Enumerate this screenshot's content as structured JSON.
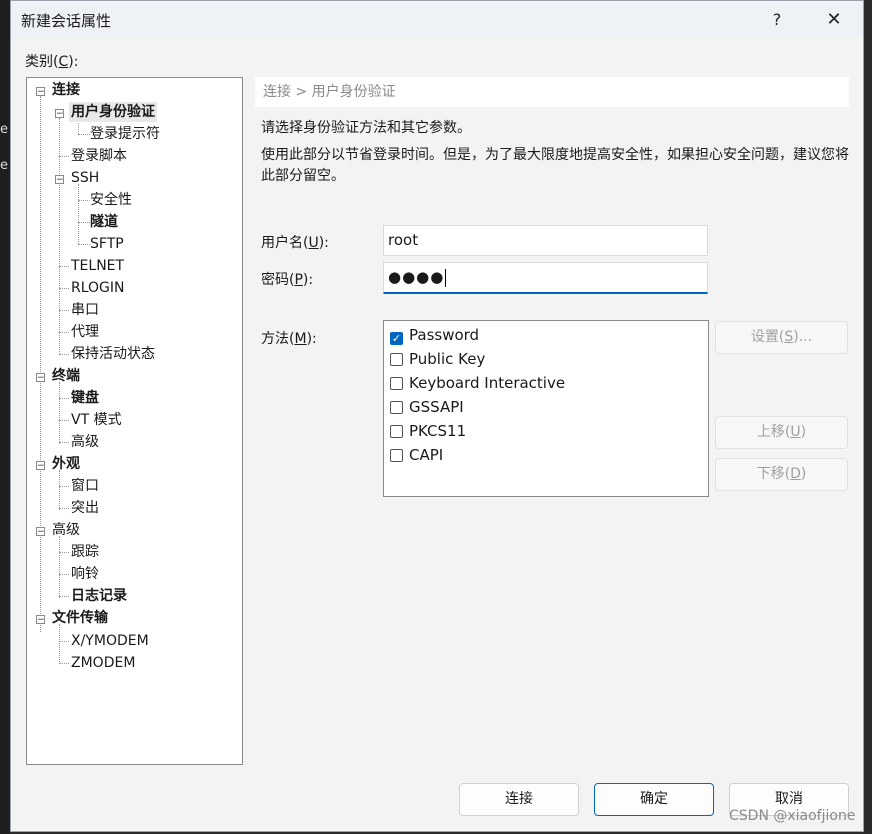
{
  "window": {
    "title": "新建会话属性",
    "help": "?",
    "close": "✕"
  },
  "background": {
    "letters": [
      "e",
      "e"
    ]
  },
  "category_label": {
    "text": "类别(",
    "key": "C",
    "suffix": "):"
  },
  "tree": {
    "nodes": [
      {
        "label": "连接",
        "bold": true,
        "expanded": true
      },
      {
        "label": "用户身份验证",
        "bold": true,
        "selected": true,
        "expanded": true
      },
      {
        "label": "登录提示符"
      },
      {
        "label": "登录脚本"
      },
      {
        "label": "SSH",
        "expanded": true
      },
      {
        "label": "安全性"
      },
      {
        "label": "隧道",
        "bold": true
      },
      {
        "label": "SFTP"
      },
      {
        "label": "TELNET"
      },
      {
        "label": "RLOGIN"
      },
      {
        "label": "串口"
      },
      {
        "label": "代理"
      },
      {
        "label": "保持活动状态"
      },
      {
        "label": "终端",
        "bold": true,
        "expanded": true
      },
      {
        "label": "键盘",
        "bold": true
      },
      {
        "label": "VT 模式"
      },
      {
        "label": "高级"
      },
      {
        "label": "外观",
        "bold": true,
        "expanded": true
      },
      {
        "label": "窗口"
      },
      {
        "label": "突出"
      },
      {
        "label": "高级",
        "expanded": true
      },
      {
        "label": "跟踪"
      },
      {
        "label": "响铃"
      },
      {
        "label": "日志记录",
        "bold": true
      },
      {
        "label": "文件传输",
        "bold": true,
        "expanded": true
      },
      {
        "label": "X/YMODEM"
      },
      {
        "label": "ZMODEM"
      }
    ],
    "expander_glyph": "−"
  },
  "breadcrumb": "连接 > 用户身份验证",
  "description": {
    "line1": "请选择身份验证方法和其它参数。",
    "line2": "使用此部分以节省登录时间。但是，为了最大限度地提高安全性，如果担心安全问题，建议您将此部分留空。"
  },
  "fields": {
    "username": {
      "label": "用户名(",
      "key": "U",
      "suffix": "):",
      "value": "root"
    },
    "password": {
      "label": "密码(",
      "key": "P",
      "suffix": "):",
      "value": "●●●●"
    },
    "method": {
      "label": "方法(",
      "key": "M",
      "suffix": "):"
    }
  },
  "methods": [
    {
      "label": "Password",
      "checked": true
    },
    {
      "label": "Public Key",
      "checked": false
    },
    {
      "label": "Keyboard Interactive",
      "checked": false
    },
    {
      "label": "GSSAPI",
      "checked": false
    },
    {
      "label": "PKCS11",
      "checked": false
    },
    {
      "label": "CAPI",
      "checked": false
    }
  ],
  "check_glyph": "✓",
  "side_buttons": {
    "settings": {
      "label": "设置(",
      "key": "S",
      "suffix": ")..."
    },
    "move_up": {
      "label": "上移(",
      "key": "U",
      "suffix": ")"
    },
    "move_down": {
      "label": "下移(",
      "key": "D",
      "suffix": ")"
    }
  },
  "footer": {
    "connect": "连接",
    "ok": "确定",
    "cancel": "取消"
  },
  "watermark": "CSDN @xiaofjione",
  "colors": {
    "accent": "#0067c0",
    "disabled_text": "#a0a0a0"
  }
}
